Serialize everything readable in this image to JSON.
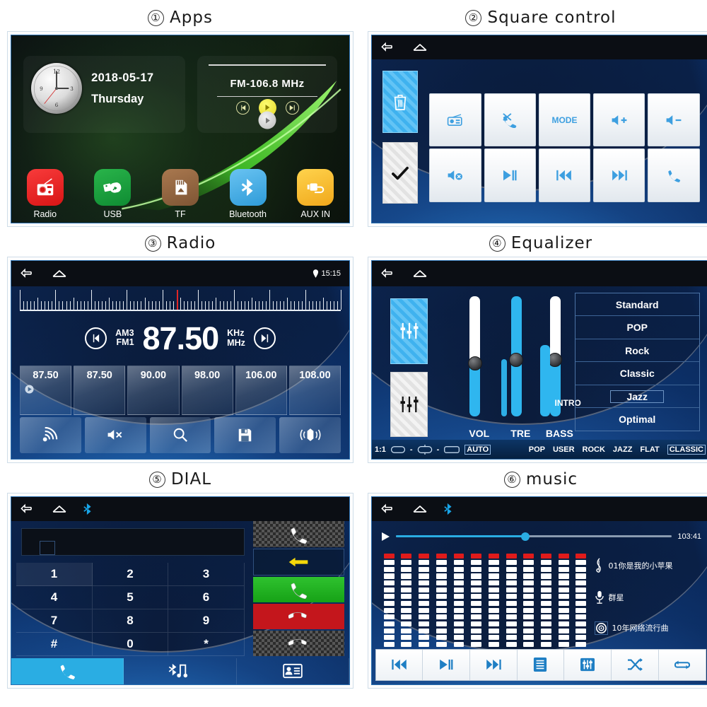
{
  "panels": [
    {
      "num": "①",
      "title": "Apps"
    },
    {
      "num": "②",
      "title": "Square control"
    },
    {
      "num": "③",
      "title": "Radio"
    },
    {
      "num": "④",
      "title": "Equalizer"
    },
    {
      "num": "⑤",
      "title": "DIAL"
    },
    {
      "num": "⑥",
      "title": "music"
    }
  ],
  "apps": {
    "date": "2018-05-17",
    "weekday": "Thursday",
    "fm_label": "FM-106.8  MHz",
    "items": [
      {
        "label": "Radio",
        "icon": "radio-icon"
      },
      {
        "label": "USB",
        "icon": "usb-icon"
      },
      {
        "label": "TF",
        "icon": "sdcard-icon"
      },
      {
        "label": "Bluetooth",
        "icon": "bluetooth-icon"
      },
      {
        "label": "AUX IN",
        "icon": "aux-plug-icon"
      }
    ]
  },
  "square_control": {
    "left_buttons": [
      {
        "icon": "trash-icon",
        "state": "active"
      },
      {
        "icon": "check-icon",
        "state": "inactive"
      }
    ],
    "buttons": [
      {
        "label": "",
        "icon": "radio-icon"
      },
      {
        "label": "",
        "icon": "call-mute-icon"
      },
      {
        "label": "MODE",
        "icon": "mode-text"
      },
      {
        "label": "",
        "icon": "volume-up-icon"
      },
      {
        "label": "",
        "icon": "volume-down-icon"
      },
      {
        "label": "",
        "icon": "mute-icon"
      },
      {
        "label": "",
        "icon": "play-pause-icon"
      },
      {
        "label": "",
        "icon": "previous-icon"
      },
      {
        "label": "",
        "icon": "next-icon"
      },
      {
        "label": "",
        "icon": "phone-icon"
      }
    ]
  },
  "radio": {
    "clock": "15:15",
    "band_top": "AM3",
    "band_bottom": "FM1",
    "frequency": "87.50",
    "unit_top": "KHz",
    "unit_bottom": "MHz",
    "presets": [
      "87.50",
      "87.50",
      "90.00",
      "98.00",
      "106.00",
      "108.00"
    ],
    "active_preset_index": 0,
    "toolbar": [
      {
        "icon": "signal-icon"
      },
      {
        "icon": "mute-icon"
      },
      {
        "icon": "search-icon"
      },
      {
        "icon": "save-icon"
      },
      {
        "icon": "loudness-icon"
      }
    ]
  },
  "equalizer": {
    "sliders": [
      {
        "label": "VOL",
        "value": 44
      },
      {
        "label": "TRE",
        "value": 47
      },
      {
        "label": "BASS",
        "value": 47
      }
    ],
    "intro_label": "INTRO",
    "presets": [
      "Standard",
      "POP",
      "Rock",
      "Classic",
      "Jazz",
      "Optimal"
    ],
    "selected_preset": "Jazz",
    "bottom": {
      "ratio": "1:1",
      "auto": "AUTO",
      "modes": [
        "POP",
        "USER",
        "ROCK",
        "JAZZ",
        "FLAT",
        "CLASSIC"
      ],
      "selected_mode": "CLASSIC"
    }
  },
  "dial": {
    "input_value": "",
    "keys": [
      "1",
      "2",
      "3",
      "4",
      "5",
      "6",
      "7",
      "8",
      "9",
      "#",
      "0",
      "*"
    ],
    "side_buttons": [
      {
        "icon": "phone-icon",
        "style": "carbon"
      },
      {
        "icon": "back-arrow-icon",
        "style": "back"
      },
      {
        "icon": "call-answer-icon",
        "style": "green"
      },
      {
        "icon": "call-end-icon",
        "style": "red"
      },
      {
        "icon": "call-hangup-icon",
        "style": "carbon"
      }
    ],
    "bottom_tabs": [
      {
        "icon": "phone-icon",
        "active": true
      },
      {
        "icon": "bluetooth-music-icon",
        "active": false
      },
      {
        "icon": "contacts-icon",
        "active": false
      }
    ]
  },
  "music": {
    "time": "103:41",
    "progress_percent": 47,
    "track_title": "01你是我的小苹果",
    "artist": "群星",
    "album": "10年网络流行曲",
    "spectrum_columns": 12,
    "spectrum_segments": 14,
    "controls": [
      {
        "icon": "previous-icon"
      },
      {
        "icon": "play-pause-icon"
      },
      {
        "icon": "next-icon"
      },
      {
        "icon": "playlist-icon"
      },
      {
        "icon": "equalizer-icon"
      },
      {
        "icon": "shuffle-icon"
      },
      {
        "icon": "repeat-icon"
      }
    ]
  },
  "colors": {
    "accent_blue": "#2aade3",
    "panel_blue": "#0a2550",
    "red": "#e01b1b",
    "green": "#2fc22f",
    "yellow": "#ffd34d"
  }
}
